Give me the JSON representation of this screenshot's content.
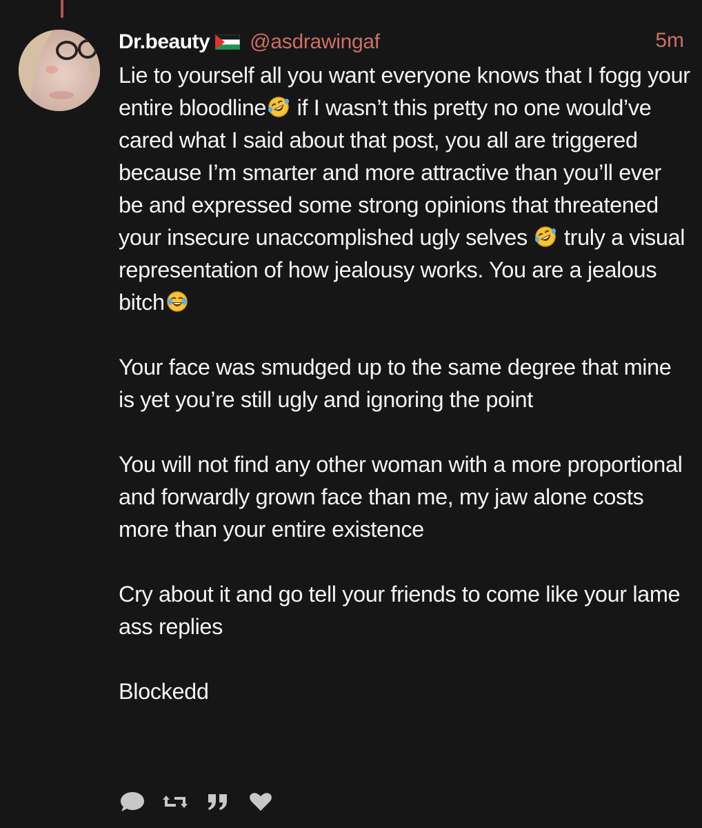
{
  "post": {
    "display_name": "Dr.beauty",
    "flag_icon": "palestine-flag-icon",
    "handle": "@asdrawingaf",
    "timestamp": "5m",
    "paragraphs": [
      {
        "segments": [
          "Lie to yourself all you want everyone knows that I fogg your entire bloodline",
          " if I wasn’t this pretty no one would’ve cared what I said about that post, you all are triggered because I’m smarter and more attractive than you’ll ever be and expressed some strong opinions that threatened your insecure unaccomplished ugly selves ",
          " truly a visual representation of how jealousy works. You are a jealous bitch"
        ],
        "emojis": [
          "rolling-on-floor-laughing-emoji",
          "rolling-on-floor-laughing-emoji",
          "face-with-tears-of-joy-emoji"
        ]
      },
      {
        "text": "Your face was smudged up to the same degree that mine is yet you’re still ugly and ignoring the point"
      },
      {
        "text": "You will not find any other woman with a more proportional and forwardly grown face than me, my jaw alone costs more than your entire existence"
      },
      {
        "text": "Cry about it and go tell your friends to come like your lame ass replies"
      },
      {
        "text": "Blockedd"
      }
    ]
  },
  "actions": [
    {
      "icon": "reply-speech-bubble-icon"
    },
    {
      "icon": "repost-arrows-icon"
    },
    {
      "icon": "quote-marks-icon"
    },
    {
      "icon": "heart-icon"
    }
  ],
  "colors": {
    "background": "#161616",
    "accent": "#cf6f66",
    "text": "#f4f4f4",
    "icon": "#c8c8c8"
  }
}
